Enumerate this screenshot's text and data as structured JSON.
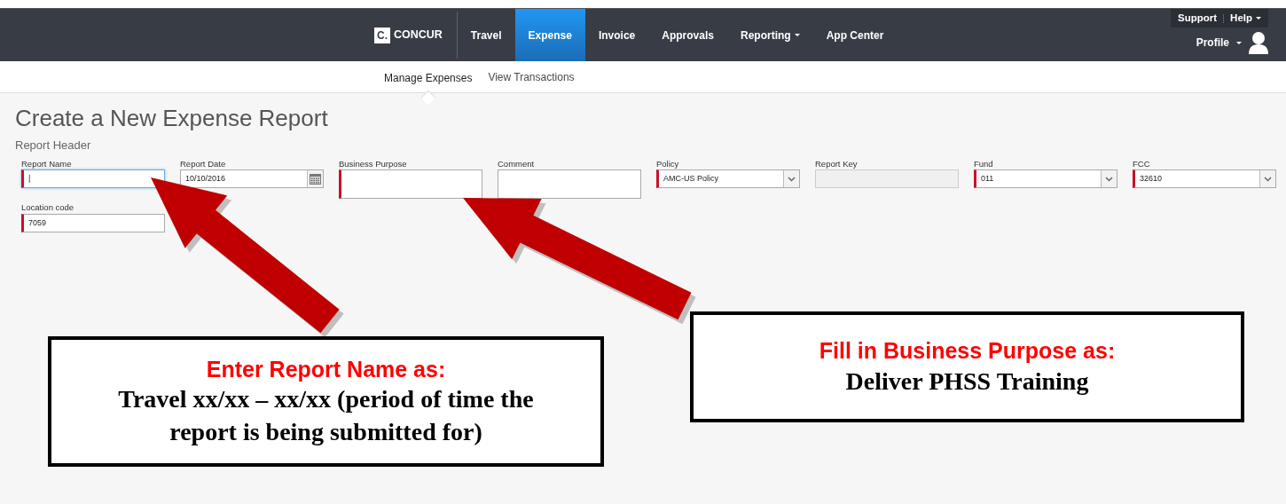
{
  "navbar": {
    "logo_mark": "C.",
    "logo_text": "CONCUR",
    "items": [
      {
        "label": "Travel",
        "selected": false,
        "dropdown": false
      },
      {
        "label": "Expense",
        "selected": true,
        "dropdown": false
      },
      {
        "label": "Invoice",
        "selected": false,
        "dropdown": false
      },
      {
        "label": "Approvals",
        "selected": false,
        "dropdown": false
      },
      {
        "label": "Reporting",
        "selected": false,
        "dropdown": true
      },
      {
        "label": "App Center",
        "selected": false,
        "dropdown": false
      }
    ],
    "utility_links": [
      {
        "label": "Support",
        "dropdown": false
      },
      {
        "label": "Help",
        "dropdown": true
      }
    ],
    "utility_separator": "|",
    "profile": {
      "label": "Profile"
    }
  },
  "subnav": [
    {
      "label": "Manage Expenses",
      "selected": true
    },
    {
      "label": "View Transactions",
      "selected": false
    }
  ],
  "page_title": "Create a New Expense Report",
  "section_title": "Report Header",
  "fields": [
    {
      "label": "Report Name",
      "kind": "text",
      "value": "|",
      "required": true,
      "focused": true,
      "tall": false
    },
    {
      "label": "Report Date",
      "kind": "date",
      "value": "10/10/2016",
      "required": false,
      "focused": false,
      "tall": false
    },
    {
      "label": "Business Purpose",
      "kind": "text",
      "required": true,
      "focused": false,
      "tall": true
    },
    {
      "label": "Comment",
      "kind": "text",
      "required": false,
      "focused": false,
      "tall": true
    },
    {
      "label": "Policy",
      "kind": "select",
      "value": "AMC-US Policy",
      "required": true,
      "focused": false,
      "tall": false
    },
    {
      "label": "Report Key",
      "kind": "readonly",
      "required": false,
      "focused": false,
      "tall": false
    },
    {
      "label": "Fund",
      "kind": "select",
      "value": "011",
      "required": true,
      "focused": false,
      "tall": false
    },
    {
      "label": "FCC",
      "kind": "select",
      "value": "32610",
      "required": true,
      "focused": false,
      "tall": false
    },
    {
      "label": "Location code",
      "kind": "text",
      "value": "7059",
      "required": true,
      "focused": false,
      "tall": false
    }
  ],
  "callouts": [
    {
      "title": "Enter Report Name as:",
      "body": "Travel xx/xx – xx/xx (period of time the report is being submitted for)"
    },
    {
      "title": "Fill in Business Purpose as:",
      "body": "Deliver PHSS Training"
    }
  ]
}
